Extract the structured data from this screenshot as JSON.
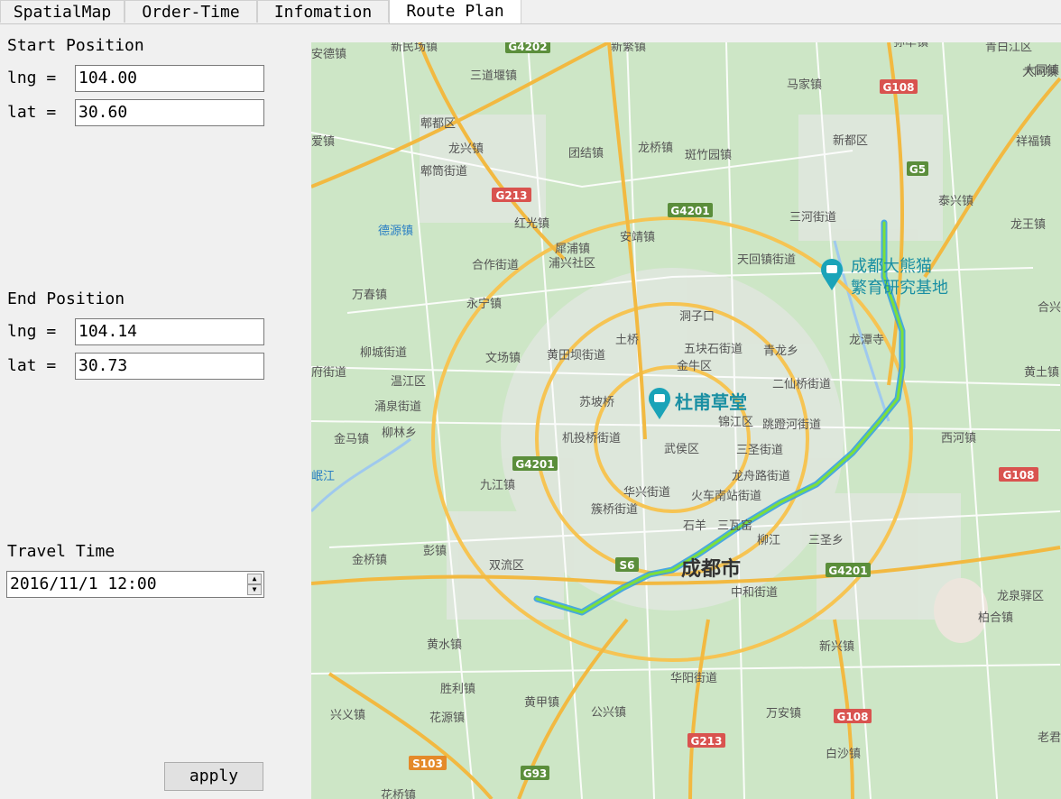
{
  "tabs": [
    {
      "label": "SpatialMap",
      "active": false
    },
    {
      "label": "Order-Time",
      "active": false
    },
    {
      "label": "Infomation",
      "active": false
    },
    {
      "label": "Route Plan",
      "active": true
    }
  ],
  "start": {
    "title": "Start Position",
    "lng_label": "lng =",
    "lat_label": "lat =",
    "lng": "104.00",
    "lat": "30.60"
  },
  "end": {
    "title": "End Position",
    "lng_label": "lng =",
    "lat_label": "lat =",
    "lng": "104.14",
    "lat": "30.73"
  },
  "travel": {
    "title": "Travel Time",
    "value": "2016/11/1 12:00"
  },
  "apply_label": "apply",
  "map": {
    "city": "成都市",
    "pois": [
      "杜甫草堂",
      "成都大熊猫",
      "繁育研究基地"
    ],
    "places": [
      "新民场镇",
      "三道堰镇",
      "新繁镇",
      "弥牟镇",
      "青白江区",
      "安德镇",
      "马家镇",
      "大同镇",
      "郫都区",
      "龙兴镇",
      "新都区",
      "祥福镇",
      "爱镇",
      "郫筒街道",
      "团结镇",
      "龙桥镇",
      "斑竹园镇",
      "红光镇",
      "泰兴镇",
      "德源镇",
      "三河街道",
      "龙王镇",
      "犀浦镇",
      "安靖镇",
      "浦兴社区",
      "合作街道",
      "天回镇街道",
      "永宁镇",
      "洞子口",
      "万春镇",
      "土桥",
      "五块石街道",
      "青龙乡",
      "龙潭寺",
      "柳城街道",
      "文场镇",
      "黄田坝街道",
      "金牛区",
      "温江区",
      "二仙桥街道",
      "苏坡桥",
      "锦江区",
      "跳蹬河街道",
      "涌泉街道",
      "柳林乡",
      "机投桥街道",
      "武侯区",
      "三圣街道",
      "西河镇",
      "金马镇",
      "九江镇",
      "华兴街道",
      "龙舟路街道",
      "岷江",
      "簇桥街道",
      "火车南站街道",
      "石羊",
      "三瓦窑",
      "彭镇",
      "双流区",
      "柳江",
      "三圣乡",
      "金桥镇",
      "中和街道",
      "龙泉驿区",
      "柏合镇",
      "黄水镇",
      "新兴镇",
      "华阳街道",
      "胜利镇",
      "黄甲镇",
      "公兴镇",
      "万安镇",
      "兴义镇",
      "花源镇",
      "白沙镇",
      "花桥镇",
      "合兴",
      "黄土镇",
      "府街道",
      "大同镇",
      "老君"
    ],
    "shields": [
      "G4202",
      "G108",
      "G5",
      "G213",
      "G4201",
      "G4201",
      "G108",
      "S6",
      "G4201",
      "G108",
      "G213",
      "S103",
      "G93"
    ],
    "route_color": "#7ddf3a"
  }
}
